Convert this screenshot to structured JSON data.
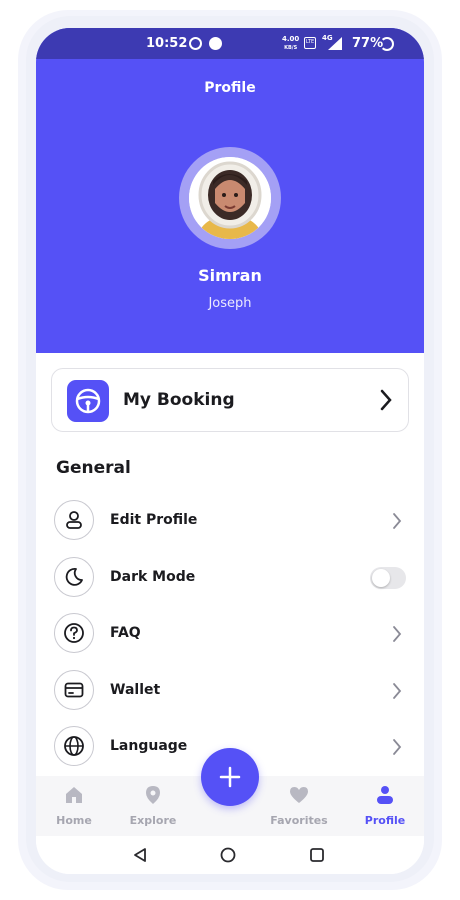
{
  "status_bar": {
    "time": "10:52",
    "net_speed_value": "4.00",
    "net_speed_unit": "KB/S",
    "lte_label": "LTE",
    "signal_label": "4G",
    "battery": "77%"
  },
  "header": {
    "title": "Profile",
    "name": "Simran",
    "subtitle": "Joseph"
  },
  "booking": {
    "label": "My Booking"
  },
  "general": {
    "heading": "General",
    "items": [
      {
        "label": "Edit Profile",
        "icon": "user-icon",
        "control": "chevron"
      },
      {
        "label": "Dark Mode",
        "icon": "moon-icon",
        "control": "toggle",
        "toggle_on": false
      },
      {
        "label": "FAQ",
        "icon": "question-icon",
        "control": "chevron"
      },
      {
        "label": "Wallet",
        "icon": "wallet-icon",
        "control": "chevron"
      },
      {
        "label": "Language",
        "icon": "globe-icon",
        "control": "chevron"
      }
    ]
  },
  "bottom_nav": {
    "items": [
      {
        "label": "Home",
        "icon": "home-icon",
        "active": false
      },
      {
        "label": "Explore",
        "icon": "location-pin-icon",
        "active": false
      },
      {
        "label": "Favorites",
        "icon": "heart-icon",
        "active": false
      },
      {
        "label": "Profile",
        "icon": "person-icon",
        "active": true
      }
    ]
  },
  "colors": {
    "brand": "#5551f6",
    "status_bar": "#3d3ab2",
    "inactive": "#a6a6b0"
  }
}
